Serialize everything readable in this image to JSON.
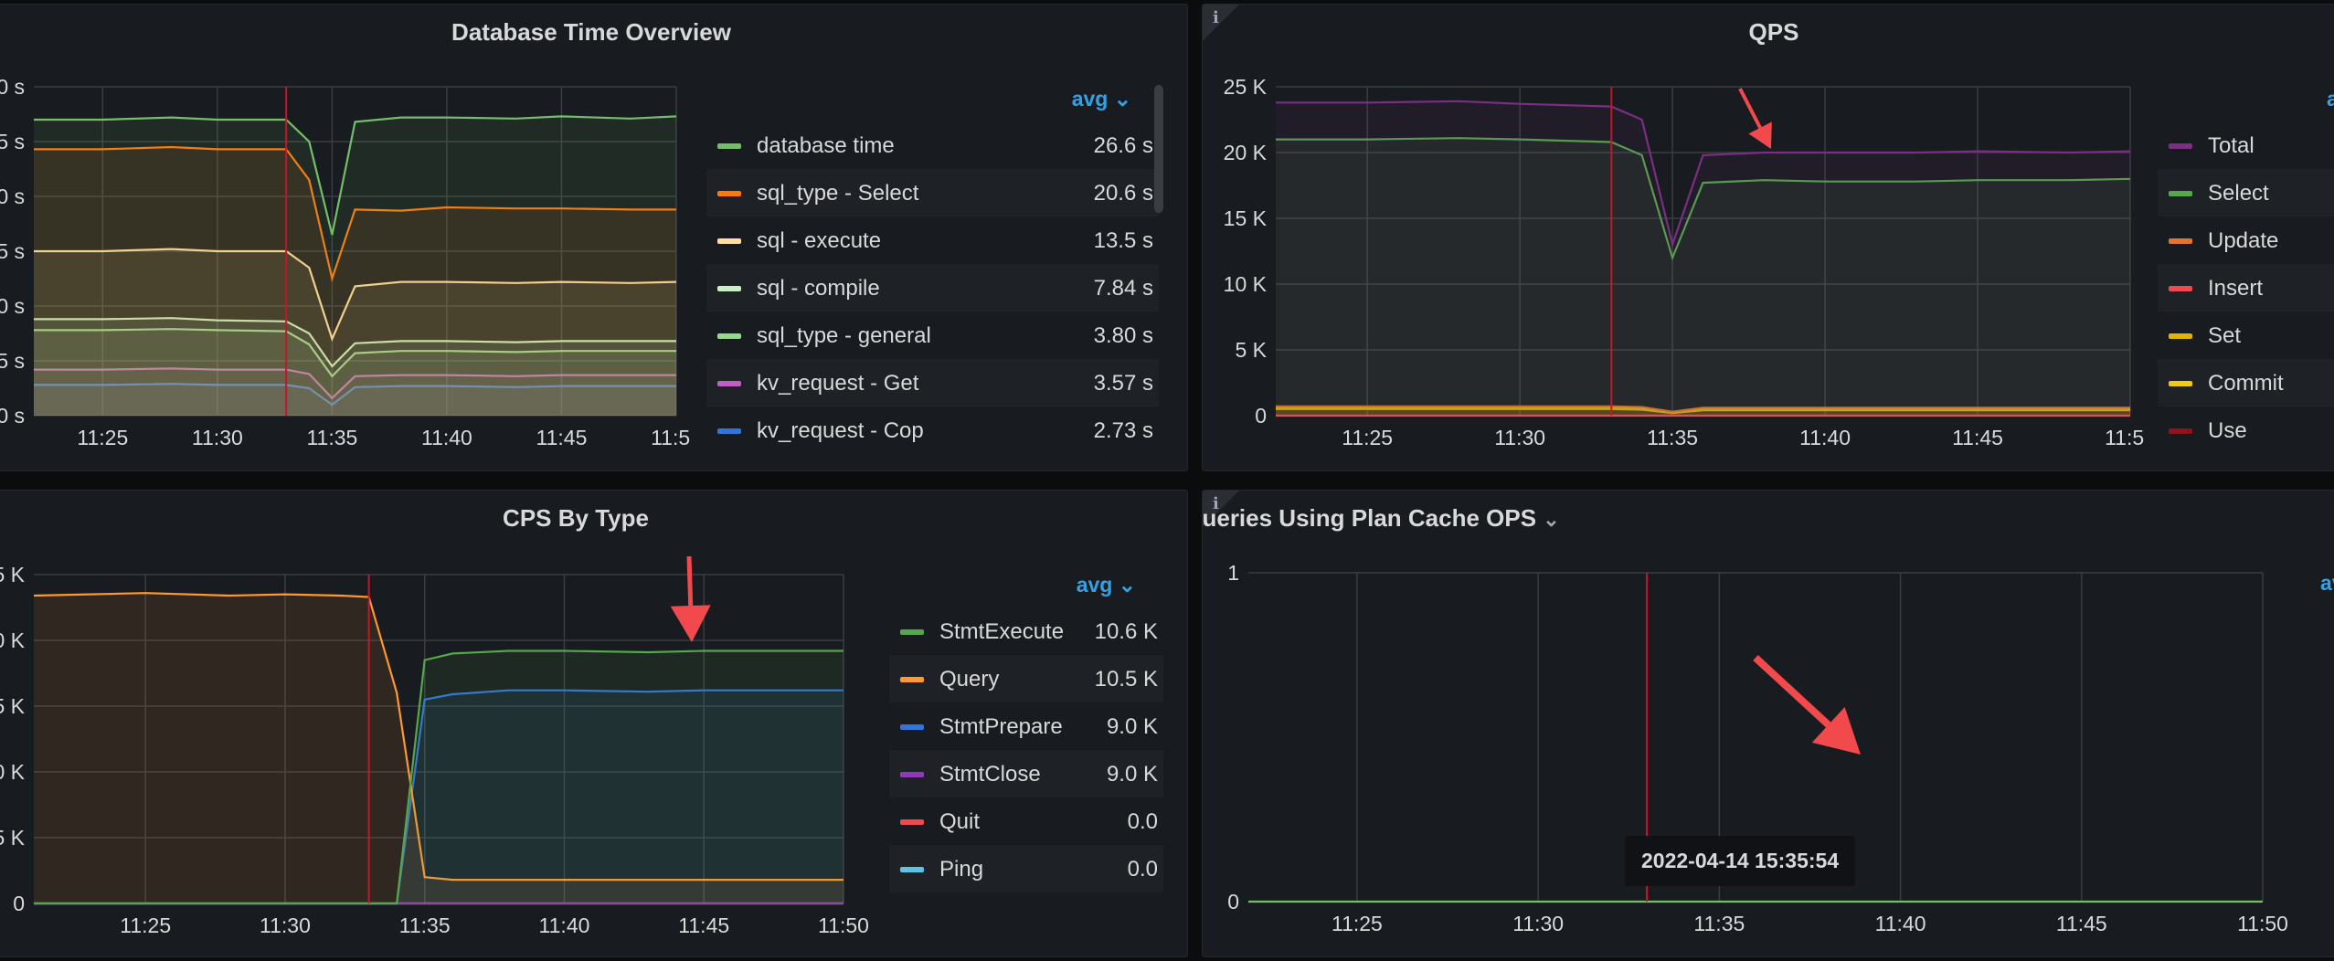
{
  "colors": {
    "panel_bg": "#181b1f",
    "grid": "#3a3d42",
    "axis_text": "#d8d9da",
    "accent": "#33a2e5",
    "annotation_red": "#c4162a",
    "arrow_red": "#f2494c"
  },
  "panels": {
    "db_time": {
      "title": "Database Time Overview",
      "legend_sort": "avg",
      "legend": [
        {
          "name": "database time",
          "value": "26.6 s",
          "color": "#73bf69"
        },
        {
          "name": "sql_type - Select",
          "value": "20.6 s",
          "color": "#ff780a"
        },
        {
          "name": "sql - execute",
          "value": "13.5 s",
          "color": "#ffdda3"
        },
        {
          "name": "sql - compile",
          "value": "7.84 s",
          "color": "#c8f2c2"
        },
        {
          "name": "sql_type - general",
          "value": "3.80 s",
          "color": "#96d98d"
        },
        {
          "name": "kv_request - Get",
          "value": "3.57 s",
          "color": "#c15ec2"
        },
        {
          "name": "kv_request - Cop",
          "value": "2.73 s",
          "color": "#3274d9"
        }
      ]
    },
    "qps": {
      "title": "QPS",
      "legend_sort_partial": "av",
      "legend": [
        {
          "name": "Total",
          "color": "#7a2f82"
        },
        {
          "name": "Select",
          "color": "#56a64b"
        },
        {
          "name": "Update",
          "color": "#e0752d"
        },
        {
          "name": "Insert",
          "color": "#f2494c"
        },
        {
          "name": "Set",
          "color": "#e0b400"
        },
        {
          "name": "Commit",
          "color": "#f2cc0c"
        },
        {
          "name": "Use",
          "color": "#8f1419"
        }
      ]
    },
    "cps": {
      "title": "CPS By Type",
      "legend_sort": "avg",
      "legend": [
        {
          "name": "StmtExecute",
          "value": "10.6 K",
          "color": "#56a64b"
        },
        {
          "name": "Query",
          "value": "10.5 K",
          "color": "#ff9830"
        },
        {
          "name": "StmtPrepare",
          "value": "9.0 K",
          "color": "#3274d9"
        },
        {
          "name": "StmtClose",
          "value": "9.0 K",
          "color": "#8f3bb8"
        },
        {
          "name": "Quit",
          "value": "0.0",
          "color": "#f2494c"
        },
        {
          "name": "Ping",
          "value": "0.0",
          "color": "#5ec4e6"
        }
      ]
    },
    "plan_cache": {
      "title": "Queries Using Plan Cache OPS",
      "legend_sort_partial": "av",
      "tooltip": "2022-04-14 15:35:54"
    }
  },
  "chart_data": [
    {
      "type": "area",
      "title": "Database Time Overview",
      "x": [
        "11:22",
        "11:25",
        "11:28",
        "11:30",
        "11:33",
        "11:34",
        "11:35",
        "11:36",
        "11:38",
        "11:40",
        "11:43",
        "11:45",
        "11:48",
        "11:50"
      ],
      "x_ticks": [
        "11:25",
        "11:30",
        "11:35",
        "11:40",
        "11:45",
        "11:50"
      ],
      "y_tick_partial": [
        "0 s",
        "5 s",
        "0 s",
        "5 s",
        "0 s",
        "5 s",
        "0 s"
      ],
      "ylim": [
        0,
        30
      ],
      "annotation_x": "11:33",
      "series": [
        {
          "name": "database time",
          "values": [
            27,
            27,
            27.2,
            27,
            27,
            25,
            16.5,
            26.8,
            27.2,
            27.2,
            27.1,
            27.3,
            27.1,
            27.3
          ]
        },
        {
          "name": "sql_type - Select",
          "values": [
            24.3,
            24.3,
            24.5,
            24.3,
            24.3,
            21.5,
            12.5,
            18.8,
            18.7,
            19,
            18.9,
            18.9,
            18.8,
            18.8
          ]
        },
        {
          "name": "sql - execute",
          "values": [
            15,
            15,
            15.2,
            15,
            15,
            13.5,
            7,
            11.8,
            12.2,
            12.2,
            12.1,
            12.2,
            12.1,
            12.2
          ]
        },
        {
          "name": "sql - compile",
          "values": [
            8.8,
            8.8,
            8.9,
            8.7,
            8.6,
            7.5,
            4.5,
            6.6,
            6.8,
            6.8,
            6.7,
            6.8,
            6.8,
            6.8
          ]
        },
        {
          "name": "sql_type - general",
          "values": [
            7.8,
            7.8,
            7.9,
            7.8,
            7.7,
            6.5,
            3.6,
            5.7,
            5.9,
            5.9,
            5.8,
            5.9,
            5.9,
            5.9
          ]
        },
        {
          "name": "kv_request - Get",
          "values": [
            4.2,
            4.2,
            4.3,
            4.2,
            4.2,
            3.8,
            1.6,
            3.6,
            3.7,
            3.7,
            3.6,
            3.7,
            3.7,
            3.7
          ]
        },
        {
          "name": "kv_request - Cop",
          "values": [
            2.8,
            2.8,
            2.9,
            2.8,
            2.8,
            2.5,
            1,
            2.6,
            2.7,
            2.7,
            2.6,
            2.7,
            2.7,
            2.7
          ]
        }
      ]
    },
    {
      "type": "area",
      "title": "QPS",
      "x": [
        "11:22",
        "11:25",
        "11:28",
        "11:30",
        "11:33",
        "11:34",
        "11:35",
        "11:36",
        "11:38",
        "11:40",
        "11:43",
        "11:45",
        "11:48",
        "11:50"
      ],
      "x_ticks": [
        "11:25",
        "11:30",
        "11:35",
        "11:40",
        "11:45",
        "11:50"
      ],
      "y_ticks": [
        "0",
        "5 K",
        "10 K",
        "15 K",
        "20 K",
        "25 K"
      ],
      "ylim": [
        0,
        25000
      ],
      "annotation_x": "11:33",
      "series": [
        {
          "name": "Total",
          "values": [
            23800,
            23800,
            23900,
            23700,
            23500,
            22500,
            13000,
            19800,
            20000,
            20000,
            20000,
            20100,
            20000,
            20100
          ]
        },
        {
          "name": "Select",
          "values": [
            21000,
            21000,
            21100,
            21000,
            20800,
            19800,
            12000,
            17700,
            17900,
            17800,
            17800,
            17900,
            17900,
            18000
          ]
        },
        {
          "name": "Update",
          "values": [
            700,
            700,
            700,
            700,
            700,
            650,
            300,
            600,
            600,
            600,
            600,
            600,
            600,
            600
          ]
        },
        {
          "name": "Insert",
          "values": [
            0,
            0,
            0,
            0,
            0,
            0,
            0,
            0,
            0,
            0,
            0,
            0,
            0,
            0
          ]
        },
        {
          "name": "Set",
          "values": [
            500,
            500,
            500,
            500,
            500,
            450,
            200,
            400,
            400,
            400,
            400,
            400,
            400,
            400
          ]
        },
        {
          "name": "Commit",
          "values": [
            600,
            600,
            600,
            600,
            600,
            550,
            250,
            500,
            500,
            500,
            500,
            500,
            500,
            500
          ]
        },
        {
          "name": "Use",
          "values": [
            0,
            0,
            0,
            0,
            0,
            0,
            0,
            0,
            0,
            0,
            0,
            0,
            0,
            0
          ]
        }
      ]
    },
    {
      "type": "area",
      "title": "CPS By Type",
      "x": [
        "11:21",
        "11:23",
        "11:25",
        "11:28",
        "11:30",
        "11:32",
        "11:33",
        "11:34",
        "11:35",
        "11:36",
        "11:38",
        "11:40",
        "11:43",
        "11:45",
        "11:48",
        "11:50"
      ],
      "x_ticks": [
        "11:25",
        "11:30",
        "11:35",
        "11:40",
        "11:45",
        "11:50"
      ],
      "y_tick_partial": [
        "0",
        "5 K",
        "0 K",
        "5 K",
        "0 K",
        "5 K"
      ],
      "ylim": [
        0,
        25000
      ],
      "annotation_x": "11:33",
      "series": [
        {
          "name": "StmtExecute",
          "values": [
            0,
            0,
            0,
            0,
            0,
            0,
            0,
            0,
            18500,
            19000,
            19200,
            19200,
            19100,
            19200,
            19200,
            19200
          ]
        },
        {
          "name": "Query",
          "values": [
            23400,
            23500,
            23600,
            23400,
            23500,
            23400,
            23300,
            16000,
            2000,
            1800,
            1800,
            1800,
            1800,
            1800,
            1800,
            1800
          ]
        },
        {
          "name": "StmtPrepare",
          "values": [
            0,
            0,
            0,
            0,
            0,
            0,
            0,
            0,
            15500,
            15900,
            16200,
            16200,
            16100,
            16200,
            16200,
            16200
          ]
        },
        {
          "name": "StmtClose",
          "values": [
            0,
            0,
            0,
            0,
            0,
            0,
            0,
            0,
            0,
            0,
            0,
            0,
            0,
            0,
            0,
            0
          ]
        },
        {
          "name": "Quit",
          "values": [
            0,
            0,
            0,
            0,
            0,
            0,
            0,
            0,
            0,
            0,
            0,
            0,
            0,
            0,
            0,
            0
          ]
        },
        {
          "name": "Ping",
          "values": [
            0,
            0,
            0,
            0,
            0,
            0,
            0,
            0,
            0,
            0,
            0,
            0,
            0,
            0,
            0,
            0
          ]
        }
      ]
    },
    {
      "type": "line",
      "title": "Queries Using Plan Cache OPS",
      "x": [
        "11:22",
        "11:50"
      ],
      "x_ticks": [
        "11:25",
        "11:30",
        "11:35",
        "11:40",
        "11:45",
        "11:50"
      ],
      "y_ticks": [
        "0",
        "1"
      ],
      "ylim": [
        0,
        1
      ],
      "annotation_x": "11:33",
      "series": [
        {
          "values": [
            0,
            0
          ]
        }
      ]
    }
  ]
}
